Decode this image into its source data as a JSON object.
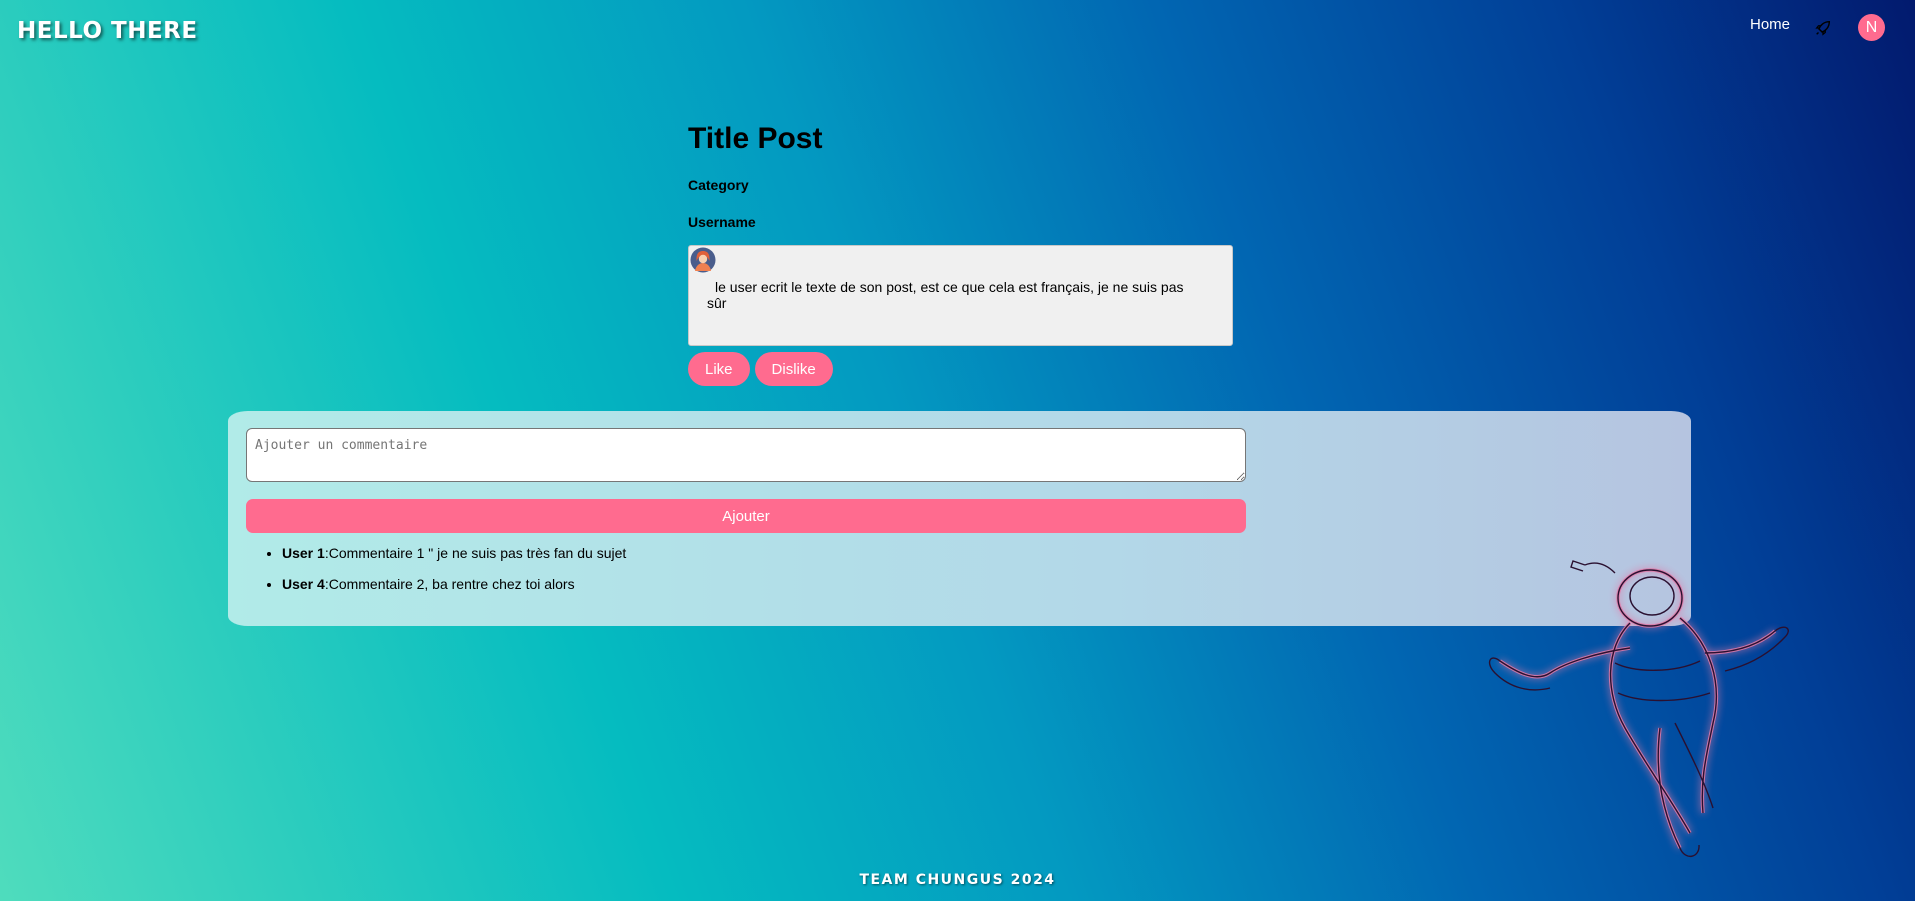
{
  "header": {
    "logo": "HELLO THERE",
    "nav_home": "Home",
    "avatar_initial": "N"
  },
  "post": {
    "title": "Title Post",
    "category": "Category",
    "username": "Username",
    "body": "le user ecrit le texte de son post, est ce que cela est français, je ne suis pas sûr",
    "like_label": "Like",
    "dislike_label": "Dislike"
  },
  "comments": {
    "placeholder": "Ajouter un commentaire",
    "add_label": "Ajouter",
    "items": [
      {
        "user": "User 1",
        "text": ":Commentaire 1 \" je ne suis pas très fan du sujet"
      },
      {
        "user": "User 4",
        "text": ":Commentaire 2, ba rentre chez toi alors"
      }
    ]
  },
  "footer": {
    "text": "TEAM CHUNGUS 2024"
  },
  "colors": {
    "accent": "#ff6b8f"
  }
}
